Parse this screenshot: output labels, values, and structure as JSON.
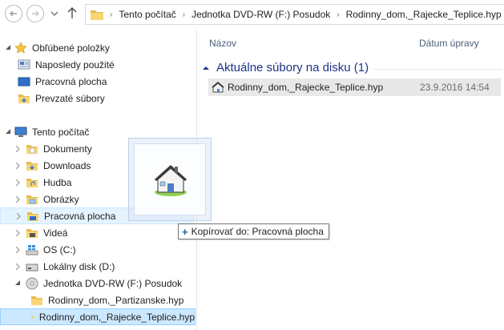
{
  "address": {
    "breadcrumbs": [
      "Tento počítač",
      "Jednotka DVD-RW (F:) Posudok",
      "Rodinny_dom,_Rajecke_Teplice.hyp"
    ]
  },
  "nav": {
    "favorites": {
      "label": "Obľúbené položky",
      "items": [
        "Naposledy použité",
        "Pracovná plocha",
        "Prevzaté súbory"
      ]
    },
    "computer": {
      "label": "Tento počítač",
      "items": [
        "Dokumenty",
        "Downloads",
        "Hudba",
        "Obrázky",
        "Pracovná plocha",
        "Videá",
        "OS (C:)",
        "Lokálny disk (D:)"
      ]
    },
    "dvd": {
      "label": "Jednotka DVD-RW (F:) Posudok",
      "items": [
        "Rodinny_dom,_Partizanske.hyp",
        "Rodinny_dom,_Rajecke_Teplice.hyp"
      ]
    }
  },
  "content": {
    "columns": {
      "name": "Názov",
      "modified": "Dátum úpravy"
    },
    "group_label": "Aktuálne súbory na disku (1)",
    "file": {
      "name": "Rodinny_dom,_Rajecke_Teplice.hyp",
      "modified": "23.9.2016 14:54"
    }
  },
  "drag": {
    "tooltip": "Kopírovať do: Pracovná plocha"
  },
  "colors": {
    "selection": "#cce8ff",
    "group_text": "#1e3287",
    "folder": "#f2c94c"
  }
}
